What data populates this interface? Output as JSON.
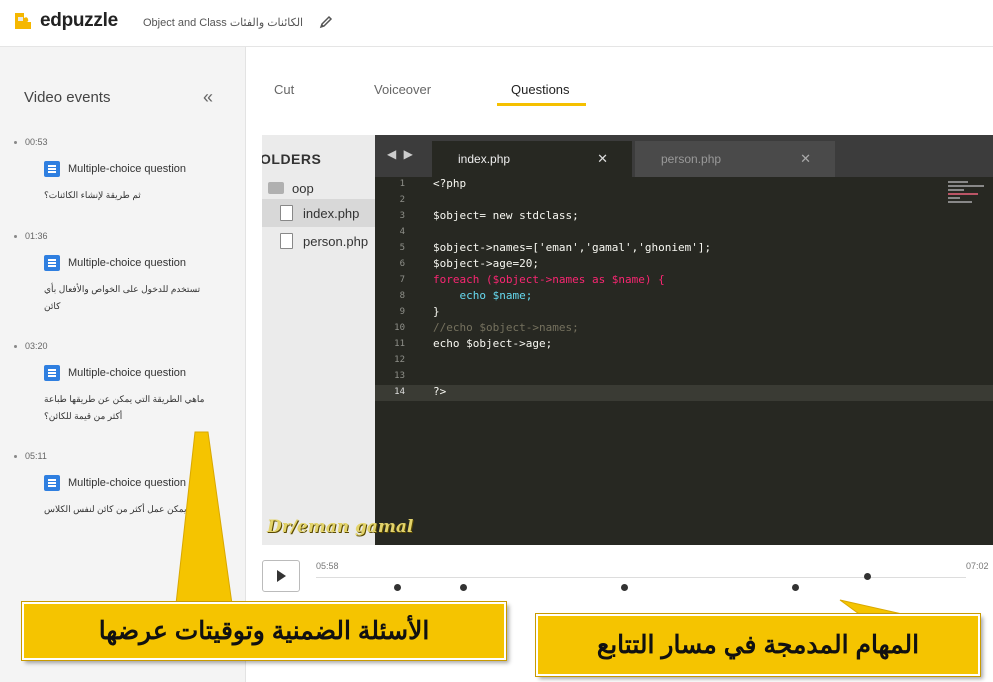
{
  "header": {
    "logo_text": "edpuzzle",
    "doc_title": "Object and Class الكائنات والفئات",
    "edit_icon": "pencil-icon"
  },
  "sidebar": {
    "title": "Video events",
    "collapse_glyph": "«",
    "events": [
      {
        "time": "00:53",
        "type": "Multiple-choice question",
        "text": "ثم طريقة لإنشاء الكائنات؟"
      },
      {
        "time": "01:36",
        "type": "Multiple-choice question",
        "text": "تستخدم للدخول على الخواص والأفعال بأي كائن"
      },
      {
        "time": "03:20",
        "type": "Multiple-choice question",
        "text": "ماهي الطريقة التي يمكن عن طريقها طباعة أكثر من قيمة للكائن؟"
      },
      {
        "time": "05:11",
        "type": "Multiple-choice question",
        "text": "يمكن عمل أكثر من كائن لنفس الكلاس"
      }
    ]
  },
  "tabs": [
    {
      "label": "Cut"
    },
    {
      "label": "Voiceover"
    },
    {
      "label": "Questions",
      "active": true
    }
  ],
  "video": {
    "folders_label": "OLDERS",
    "tree": [
      {
        "label": "oop",
        "kind": "folder"
      },
      {
        "label": "index.php",
        "kind": "file",
        "selected": true
      },
      {
        "label": "person.php",
        "kind": "file"
      }
    ],
    "nav_arrows": "◀ ▶",
    "editor_tabs": [
      {
        "label": "index.php",
        "active": true,
        "close": "✕"
      },
      {
        "label": "person.php",
        "active": false,
        "close": "✕"
      }
    ],
    "line_numbers": [
      "1",
      "2",
      "3",
      "4",
      "5",
      "6",
      "7",
      "8",
      "9",
      "10",
      "11",
      "12",
      "13",
      "14"
    ],
    "code_lines": [
      "<?php",
      "",
      "$object= new stdclass;",
      "",
      "$object->names=['eman','gamal','ghoniem'];",
      "$object->age=20;",
      "foreach ($object->names as $name) {",
      "    echo $name;",
      "}",
      "//echo $object->names;",
      "echo $object->age;",
      "",
      "",
      "?>"
    ],
    "watermark": "Dr/eman gamal"
  },
  "player": {
    "current_time": "05:58",
    "total_time": "07:02",
    "marker_times": [
      "00:53",
      "01:36",
      "03:20",
      "05:11"
    ],
    "playhead_time": "05:58"
  },
  "callouts": {
    "left": "الأسئلة الضمنية وتوقيتات عرضها",
    "right": "المهام المدمجة في مسار التتابع"
  },
  "colors": {
    "accent_yellow": "#f5c400",
    "question_blue": "#2f7fe0",
    "editor_bg": "#272822"
  }
}
